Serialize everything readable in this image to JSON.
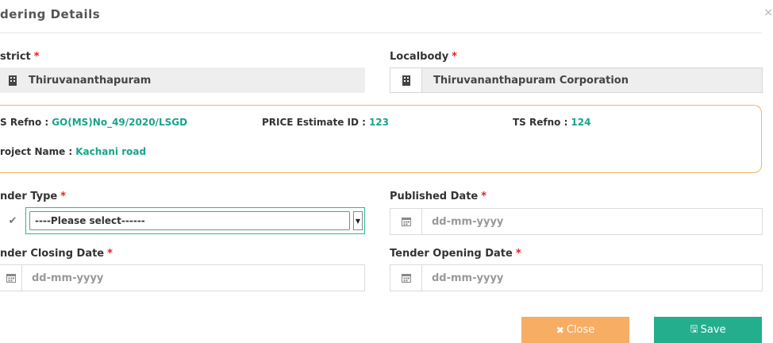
{
  "modal": {
    "title": "dering Details",
    "close_glyph": "×"
  },
  "fields": {
    "district": {
      "label": "strict",
      "required": "*",
      "value": "Thiruvananthapuram",
      "icon": "building-icon"
    },
    "localbody": {
      "label": "Localbody",
      "required": "*",
      "value": "Thiruvananthapuram Corporation",
      "icon": "building-icon"
    },
    "tender_type": {
      "label": "nder Type",
      "required": "*",
      "selected": "----Please select------",
      "icon": "check-icon"
    },
    "published_date": {
      "label": "Published Date",
      "required": "*",
      "placeholder": "dd-mm-yyyy",
      "icon": "calendar-icon"
    },
    "closing_date": {
      "label": "nder Closing Date",
      "required": "*",
      "placeholder": "dd-mm-yyyy",
      "icon": "calendar-icon"
    },
    "opening_date": {
      "label": "Tender Opening Date",
      "required": "*",
      "placeholder": "dd-mm-yyyy",
      "icon": "calendar-icon"
    }
  },
  "info": {
    "as_refno_label": "S Refno :",
    "as_refno_value": "GO(MS)No_49/2020/LSGD",
    "price_label": "PRICE Estimate ID :",
    "price_value": "123",
    "ts_label": "TS Refno :",
    "ts_value": "124",
    "project_label": "roject Name :",
    "project_value": "Kachani road"
  },
  "buttons": {
    "close_label": "Close",
    "close_icon": "✖",
    "save_label": "Save",
    "save_icon": "🖫"
  },
  "colors": {
    "accent_green": "#23ae8e",
    "accent_orange": "#f7ad63",
    "required_red": "#e02020"
  }
}
